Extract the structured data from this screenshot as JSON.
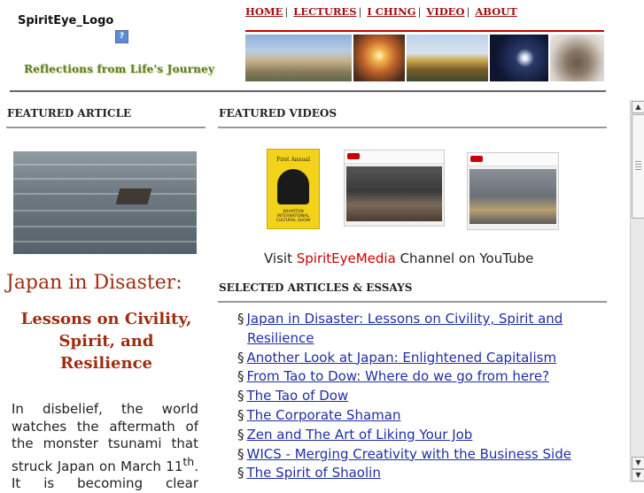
{
  "header": {
    "logo_alt": "SpiritEye_Logo",
    "broken_image_glyph": "?",
    "tagline": "Reflections from Life's Journey",
    "nav": [
      {
        "label": "HOME"
      },
      {
        "label": "LECTURES"
      },
      {
        "label": "I CHING"
      },
      {
        "label": "VIDEO"
      },
      {
        "label": "ABOUT"
      }
    ],
    "nav_separator": "|",
    "banner_photos": [
      "palace-photo",
      "sunset-photo",
      "temple-photo",
      "moon-photo",
      "buddha-photo"
    ]
  },
  "featured_article": {
    "section_title": "FEATURED ARTICLE",
    "image_subject": "house-floating-in-sea",
    "headline": "Japan in Disaster:",
    "subhead": "Lessons on Civility, Spirit, and Resilience",
    "body_text": "In disbelief, the world watches the aftermath of the monster tsunami that struck Japan on March 11",
    "body_sup": "th",
    "body_tail": ". It is becoming clear"
  },
  "featured_videos": {
    "section_title": "FEATURED VIDEOS",
    "poster_title": "First Annual",
    "poster_footer": "WHARTON INTERNATIONAL CULTURAL SHOW",
    "visit_prefix": "Visit ",
    "visit_link": "SpiritEyeMedia",
    "visit_suffix": " Channel on YouTube"
  },
  "selected_articles": {
    "section_title": "SELECTED ARTICLES & ESSAYS",
    "bullet": "§",
    "items": [
      {
        "label": "Japan in Disaster: Lessons on Civility, Spirit and Resilience"
      },
      {
        "label": "Another Look at Japan: Enlightened Capitalism"
      },
      {
        "label": "From Tao to Dow: Where do we go from here?"
      },
      {
        "label": "The Tao of Dow"
      },
      {
        "label": "The Corporate Shaman"
      },
      {
        "label": "Zen and The Art of Liking Your Job"
      },
      {
        "label": "WICS - Merging Creativity with the Business Side"
      },
      {
        "label": "The Spirit of Shaolin"
      }
    ]
  },
  "scrollbar": {
    "up_arrow": "▲",
    "down_arrow": "▼"
  },
  "colors": {
    "accent_red": "#a02c10",
    "link_blue": "#1f2fa5",
    "tagline_green": "#5a7d2e"
  }
}
